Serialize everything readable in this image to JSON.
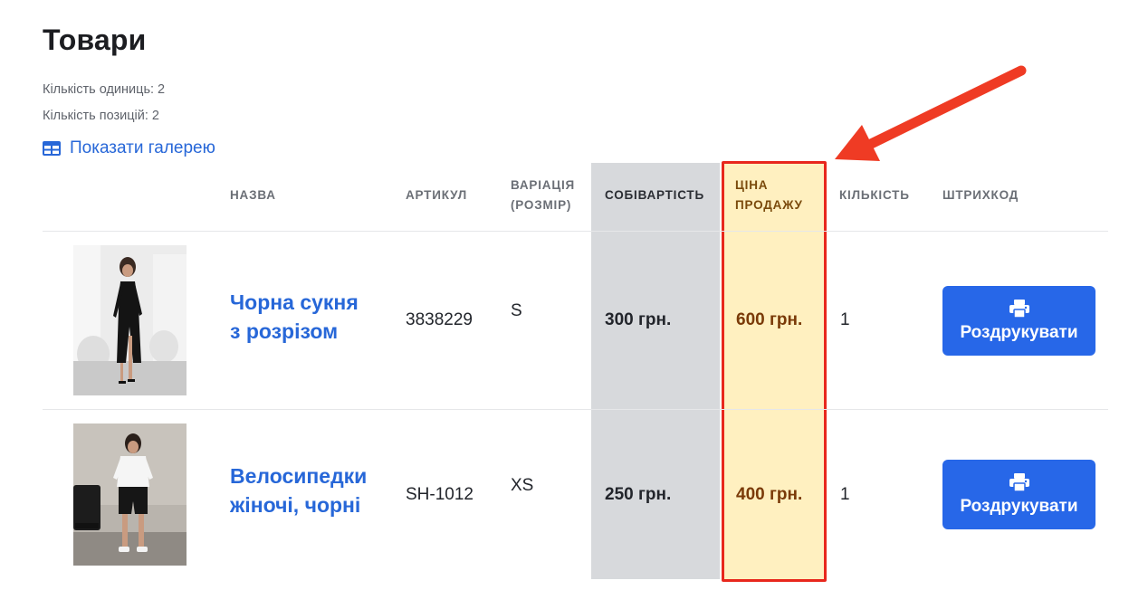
{
  "page": {
    "title": "Товари",
    "units_count": "Кількість одиниць: 2",
    "positions_count": "Кількість позицій: 2",
    "gallery_link": "Показати галерею"
  },
  "table": {
    "headers": {
      "name": "НАЗВА",
      "sku": "АРТИКУЛ",
      "variation_line1": "ВАРІАЦІЯ",
      "variation_line2": "(РОЗМІР)",
      "cost": "СОБІВАРТІСТЬ",
      "price_line1": "ЦІНА",
      "price_line2": "ПРОДАЖУ",
      "quantity": "КІЛЬКІСТЬ",
      "barcode": "ШТРИХКОД"
    },
    "rows": [
      {
        "name_line1": "Чорна сукня",
        "name_line2": "з розрізом",
        "sku": "3838229",
        "variation": "S",
        "cost": "300 грн.",
        "price": "600 грн.",
        "quantity": "1",
        "print_label": "Роздрукувати"
      },
      {
        "name_line1": "Велосипедки",
        "name_line2": "жіночі, чорні",
        "sku": "SH-1012",
        "variation": "XS",
        "cost": "250 грн.",
        "price": "400 грн.",
        "quantity": "1",
        "print_label": "Роздрукувати"
      }
    ]
  },
  "colors": {
    "accent": "#2767e8",
    "highlight_border": "#e8271d",
    "highlight_fill": "#fff0c0",
    "cost_column_fill": "#d7d9dc"
  },
  "icons": [
    "table-grid-icon",
    "printer-icon",
    "annotation-arrow"
  ]
}
